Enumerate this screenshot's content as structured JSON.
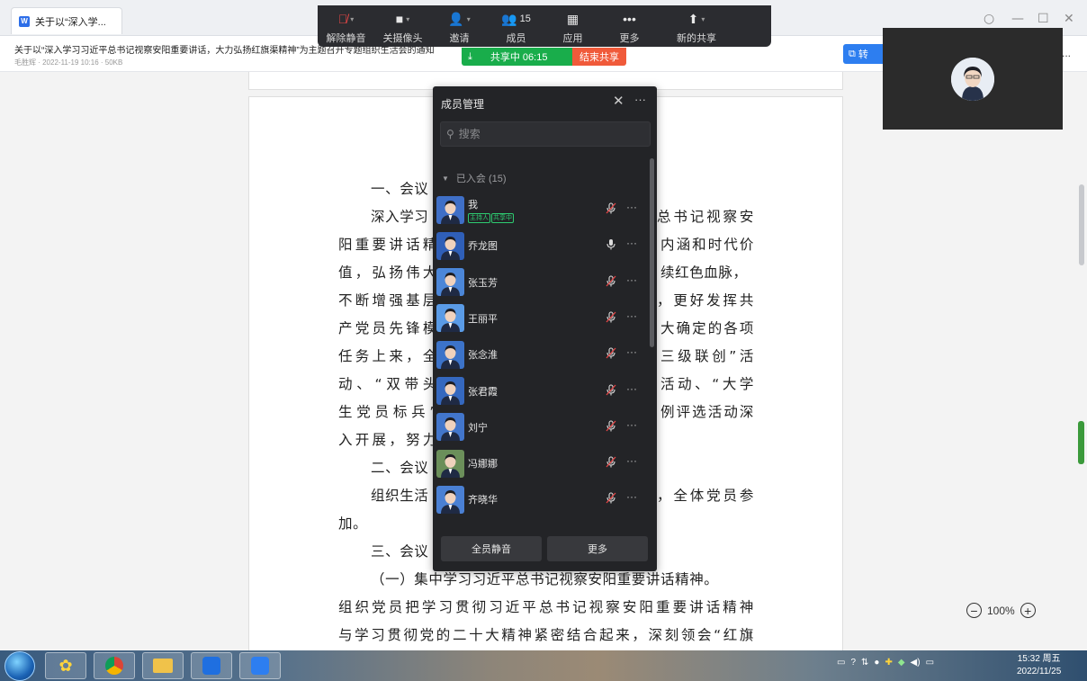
{
  "tab": {
    "title": "关于以“深入学..."
  },
  "window_controls": {
    "restore": "○",
    "minimize": "—",
    "maximize": "☐",
    "close": "✕"
  },
  "doc": {
    "title": "关于以“深入学习习近平总书记视察安阳重要讲话，大力弘扬红旗渠精神”为主题召开专题组织生活会的通知",
    "meta": "毛胜辉 · 2022-11-19 10:16 · 50KB",
    "convert_label": "转",
    "more_label": "...",
    "lines": [
      "一、会议",
      "深入学习",
      "总书记视察安",
      "阳重要讲话精",
      "内涵和时代价",
      "值，弘扬伟大",
      "续红色血脉，",
      "不断增强基层",
      "，更好发挥共",
      "产党员先锋模",
      "大确定的各项",
      "任务上来，全",
      "三级联创”活",
      "动、“双带头",
      "活动、“大学",
      "生党员标兵”",
      "例评选活动深",
      "入开展，努力",
      "二、会议",
      "组织生活",
      "，全体党员参",
      "加。",
      "三、会议",
      "（一）集中学习习近平总书记视察安阳重要讲话精神。",
      "组织党员把学习贯彻习近平总书记视察安阳重要讲话精神",
      "与学习贯彻党的二十大精神紧密结合起来，深刻领会“红旗"
    ]
  },
  "zoom": {
    "level": "100%",
    "minus": "−",
    "plus": "+"
  },
  "meeting_toolbar": {
    "unmute": "解除静音",
    "camera_off": "关摄像头",
    "invite": "邀请",
    "members": "成员",
    "members_count": "15",
    "apps": "应用",
    "more": "更多",
    "new_share": "新的共享"
  },
  "share_status": {
    "text": "共享中 06:15",
    "end": "结束共享"
  },
  "panel": {
    "title": "成员管理",
    "search_placeholder": "搜索",
    "group_label": "已入会 (15)",
    "mute_all": "全员静音",
    "more": "更多",
    "members": [
      {
        "name": "我",
        "tags": [
          "主持人",
          "共享中"
        ],
        "mic": "muted"
      },
      {
        "name": "乔龙图",
        "tags": [],
        "mic": "on"
      },
      {
        "name": "张玉芳",
        "tags": [],
        "mic": "muted"
      },
      {
        "name": "王丽平",
        "tags": [],
        "mic": "muted"
      },
      {
        "name": "张念淮",
        "tags": [],
        "mic": "muted"
      },
      {
        "name": "张君霞",
        "tags": [],
        "mic": "muted"
      },
      {
        "name": "刘宁",
        "tags": [],
        "mic": "muted"
      },
      {
        "name": "冯娜娜",
        "tags": [],
        "mic": "muted"
      },
      {
        "name": "齐晓华",
        "tags": [],
        "mic": "muted"
      }
    ]
  },
  "taskbar": {
    "time": "15:32 周五",
    "date": "2022/11/25"
  }
}
